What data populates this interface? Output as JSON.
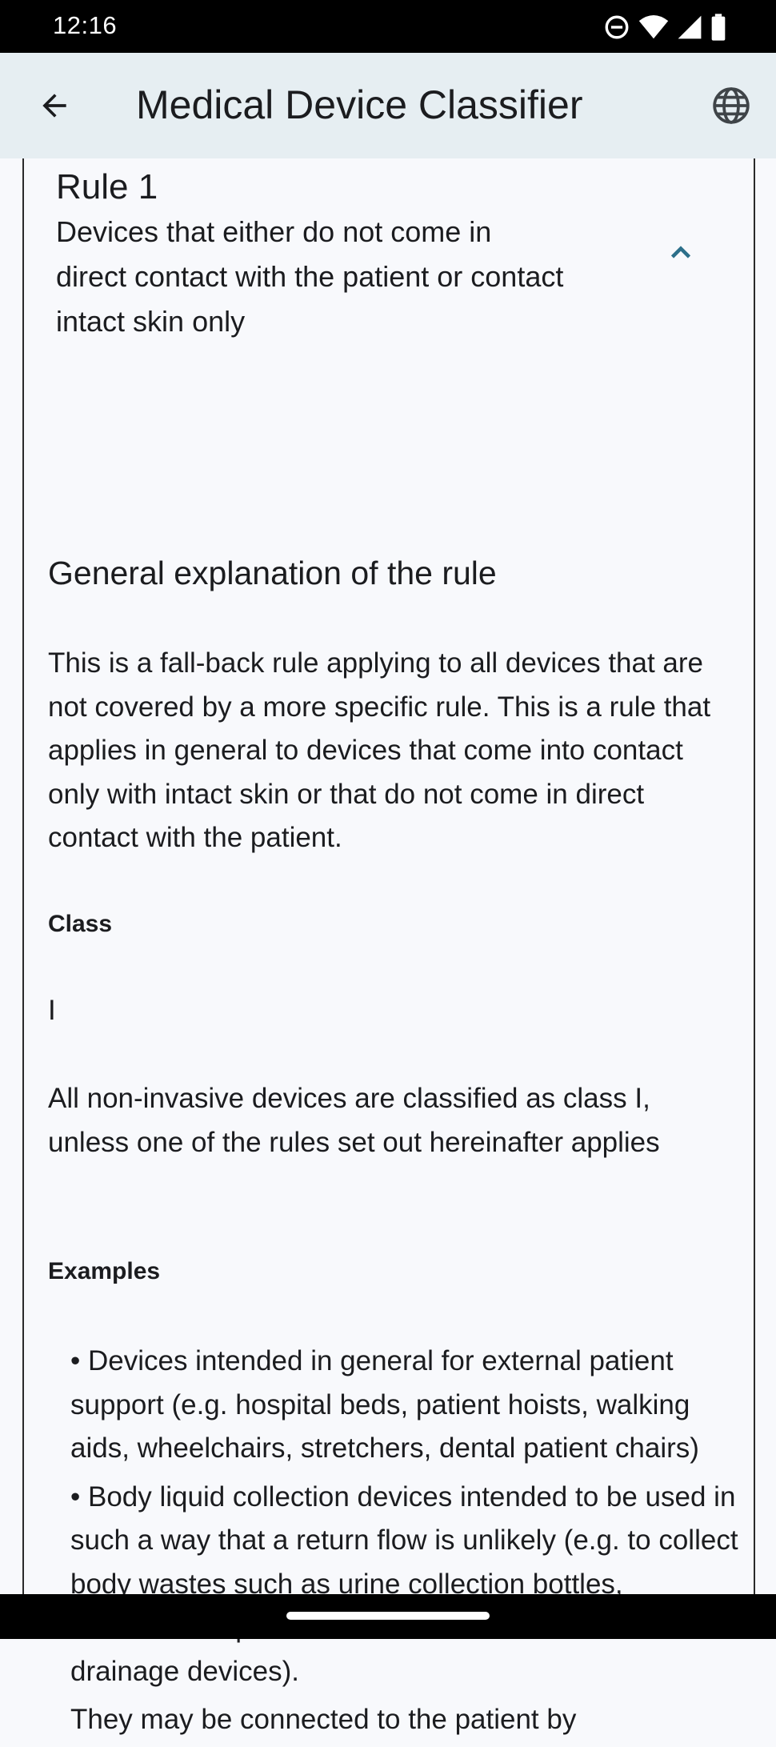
{
  "status_bar": {
    "time": "12:16",
    "icons": [
      "do-not-disturb-icon",
      "wifi-icon",
      "cell-signal-icon",
      "battery-icon"
    ]
  },
  "app_bar": {
    "title": "Medical Device Classifier",
    "back_icon": "arrow-back-icon",
    "language_icon": "globe-icon"
  },
  "rule": {
    "title": "Rule 1",
    "subtitle": "Devices that either do not come in direct contact with the patient or contact intact skin only",
    "expanded": true
  },
  "content": {
    "explanation_heading": "General explanation of the rule",
    "explanation_text": "This is a fall-back rule applying to all devices that are not covered by a more specific rule. This is a rule that applies in general to devices that come into contact only with intact skin or that do not come in direct contact with the patient.",
    "class_label": "Class",
    "class_value": "I",
    "class_text": "All non-invasive devices are classified as class I, unless one of the rules set out hereinafter applies",
    "examples_label": "Examples",
    "examples": [
      "• Devices intended in general for external patient support (e.g. hospital beds, patient hoists, walking aids, wheelchairs, stretchers, dental patient chairs)",
      "• Body liquid collection devices intended to be used in such a way that a return flow is unlikely (e.g. to collect body wastes such as urine collection bottles, incontinence pads or collectors used with wound drainage devices).",
      "They may be connected to the patient by"
    ]
  },
  "colors": {
    "app_bar_bg": "#e6eef2",
    "page_bg": "#f8f9fc",
    "accent": "#2c6f8a"
  }
}
